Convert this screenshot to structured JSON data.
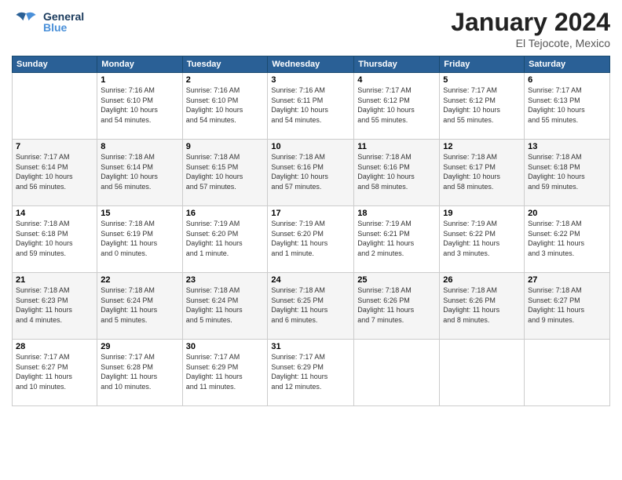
{
  "header": {
    "logo_general": "General",
    "logo_blue": "Blue",
    "month_title": "January 2024",
    "location": "El Tejocote, Mexico"
  },
  "days_of_week": [
    "Sunday",
    "Monday",
    "Tuesday",
    "Wednesday",
    "Thursday",
    "Friday",
    "Saturday"
  ],
  "weeks": [
    [
      {
        "day": "",
        "info": ""
      },
      {
        "day": "1",
        "info": "Sunrise: 7:16 AM\nSunset: 6:10 PM\nDaylight: 10 hours\nand 54 minutes."
      },
      {
        "day": "2",
        "info": "Sunrise: 7:16 AM\nSunset: 6:10 PM\nDaylight: 10 hours\nand 54 minutes."
      },
      {
        "day": "3",
        "info": "Sunrise: 7:16 AM\nSunset: 6:11 PM\nDaylight: 10 hours\nand 54 minutes."
      },
      {
        "day": "4",
        "info": "Sunrise: 7:17 AM\nSunset: 6:12 PM\nDaylight: 10 hours\nand 55 minutes."
      },
      {
        "day": "5",
        "info": "Sunrise: 7:17 AM\nSunset: 6:12 PM\nDaylight: 10 hours\nand 55 minutes."
      },
      {
        "day": "6",
        "info": "Sunrise: 7:17 AM\nSunset: 6:13 PM\nDaylight: 10 hours\nand 55 minutes."
      }
    ],
    [
      {
        "day": "7",
        "info": "Sunrise: 7:17 AM\nSunset: 6:14 PM\nDaylight: 10 hours\nand 56 minutes."
      },
      {
        "day": "8",
        "info": "Sunrise: 7:18 AM\nSunset: 6:14 PM\nDaylight: 10 hours\nand 56 minutes."
      },
      {
        "day": "9",
        "info": "Sunrise: 7:18 AM\nSunset: 6:15 PM\nDaylight: 10 hours\nand 57 minutes."
      },
      {
        "day": "10",
        "info": "Sunrise: 7:18 AM\nSunset: 6:16 PM\nDaylight: 10 hours\nand 57 minutes."
      },
      {
        "day": "11",
        "info": "Sunrise: 7:18 AM\nSunset: 6:16 PM\nDaylight: 10 hours\nand 58 minutes."
      },
      {
        "day": "12",
        "info": "Sunrise: 7:18 AM\nSunset: 6:17 PM\nDaylight: 10 hours\nand 58 minutes."
      },
      {
        "day": "13",
        "info": "Sunrise: 7:18 AM\nSunset: 6:18 PM\nDaylight: 10 hours\nand 59 minutes."
      }
    ],
    [
      {
        "day": "14",
        "info": "Sunrise: 7:18 AM\nSunset: 6:18 PM\nDaylight: 10 hours\nand 59 minutes."
      },
      {
        "day": "15",
        "info": "Sunrise: 7:18 AM\nSunset: 6:19 PM\nDaylight: 11 hours\nand 0 minutes."
      },
      {
        "day": "16",
        "info": "Sunrise: 7:19 AM\nSunset: 6:20 PM\nDaylight: 11 hours\nand 1 minute."
      },
      {
        "day": "17",
        "info": "Sunrise: 7:19 AM\nSunset: 6:20 PM\nDaylight: 11 hours\nand 1 minute."
      },
      {
        "day": "18",
        "info": "Sunrise: 7:19 AM\nSunset: 6:21 PM\nDaylight: 11 hours\nand 2 minutes."
      },
      {
        "day": "19",
        "info": "Sunrise: 7:19 AM\nSunset: 6:22 PM\nDaylight: 11 hours\nand 3 minutes."
      },
      {
        "day": "20",
        "info": "Sunrise: 7:18 AM\nSunset: 6:22 PM\nDaylight: 11 hours\nand 3 minutes."
      }
    ],
    [
      {
        "day": "21",
        "info": "Sunrise: 7:18 AM\nSunset: 6:23 PM\nDaylight: 11 hours\nand 4 minutes."
      },
      {
        "day": "22",
        "info": "Sunrise: 7:18 AM\nSunset: 6:24 PM\nDaylight: 11 hours\nand 5 minutes."
      },
      {
        "day": "23",
        "info": "Sunrise: 7:18 AM\nSunset: 6:24 PM\nDaylight: 11 hours\nand 5 minutes."
      },
      {
        "day": "24",
        "info": "Sunrise: 7:18 AM\nSunset: 6:25 PM\nDaylight: 11 hours\nand 6 minutes."
      },
      {
        "day": "25",
        "info": "Sunrise: 7:18 AM\nSunset: 6:26 PM\nDaylight: 11 hours\nand 7 minutes."
      },
      {
        "day": "26",
        "info": "Sunrise: 7:18 AM\nSunset: 6:26 PM\nDaylight: 11 hours\nand 8 minutes."
      },
      {
        "day": "27",
        "info": "Sunrise: 7:18 AM\nSunset: 6:27 PM\nDaylight: 11 hours\nand 9 minutes."
      }
    ],
    [
      {
        "day": "28",
        "info": "Sunrise: 7:17 AM\nSunset: 6:27 PM\nDaylight: 11 hours\nand 10 minutes."
      },
      {
        "day": "29",
        "info": "Sunrise: 7:17 AM\nSunset: 6:28 PM\nDaylight: 11 hours\nand 10 minutes."
      },
      {
        "day": "30",
        "info": "Sunrise: 7:17 AM\nSunset: 6:29 PM\nDaylight: 11 hours\nand 11 minutes."
      },
      {
        "day": "31",
        "info": "Sunrise: 7:17 AM\nSunset: 6:29 PM\nDaylight: 11 hours\nand 12 minutes."
      },
      {
        "day": "",
        "info": ""
      },
      {
        "day": "",
        "info": ""
      },
      {
        "day": "",
        "info": ""
      }
    ]
  ]
}
